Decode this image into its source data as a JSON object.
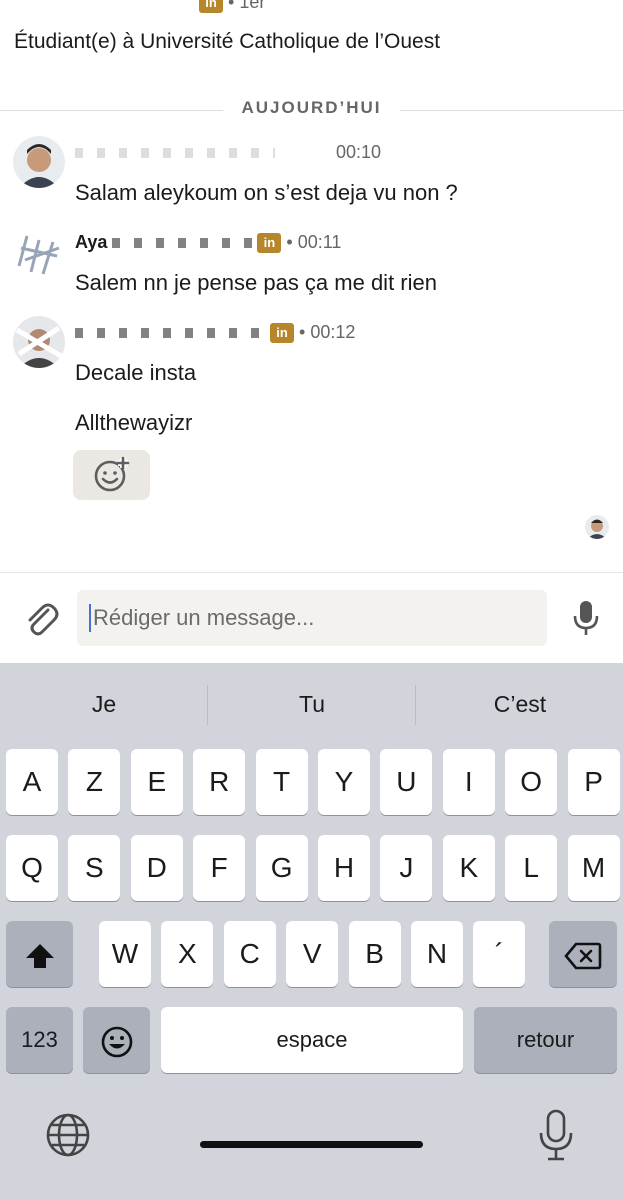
{
  "header": {
    "time_suffix": "1er",
    "headline": "Étudiant(e) à Université Catholique de l’Ouest",
    "premium_badge": "in"
  },
  "divider": {
    "label": "AUJOURD’HUI"
  },
  "messages": [
    {
      "name": "",
      "time": "00:10",
      "text": "Salam aleykoum on s’est deja vu non ?"
    },
    {
      "name": "Aya",
      "time": "00:11",
      "text": "Salem nn je pense pas ça me dit rien"
    },
    {
      "name": "",
      "time": "00:12",
      "texts": [
        "Decale insta",
        "Allthewayizr"
      ]
    }
  ],
  "composer": {
    "placeholder": "Rédiger un message..."
  },
  "keyboard": {
    "suggestions": [
      "Je",
      "Tu",
      "C’est"
    ],
    "row1": [
      "A",
      "Z",
      "E",
      "R",
      "T",
      "Y",
      "U",
      "I",
      "O",
      "P"
    ],
    "row2": [
      "Q",
      "S",
      "D",
      "F",
      "G",
      "H",
      "J",
      "K",
      "L",
      "M"
    ],
    "row3": [
      "W",
      "X",
      "C",
      "V",
      "B",
      "N",
      "´"
    ],
    "numbers_label": "123",
    "space_label": "espace",
    "return_label": "retour"
  },
  "icons": {
    "premium": "linkedin-premium-icon",
    "reaction": "add-reaction-icon",
    "attach": "paperclip-icon",
    "mic": "microphone-icon",
    "shift": "shift-icon",
    "delete": "delete-icon",
    "emoji": "emoji-icon",
    "globe": "globe-icon",
    "dictation": "dictation-icon"
  },
  "colors": {
    "premium": "#b7862a",
    "caret": "#4a70d6",
    "keyboard_bg": "#d1d4db"
  }
}
